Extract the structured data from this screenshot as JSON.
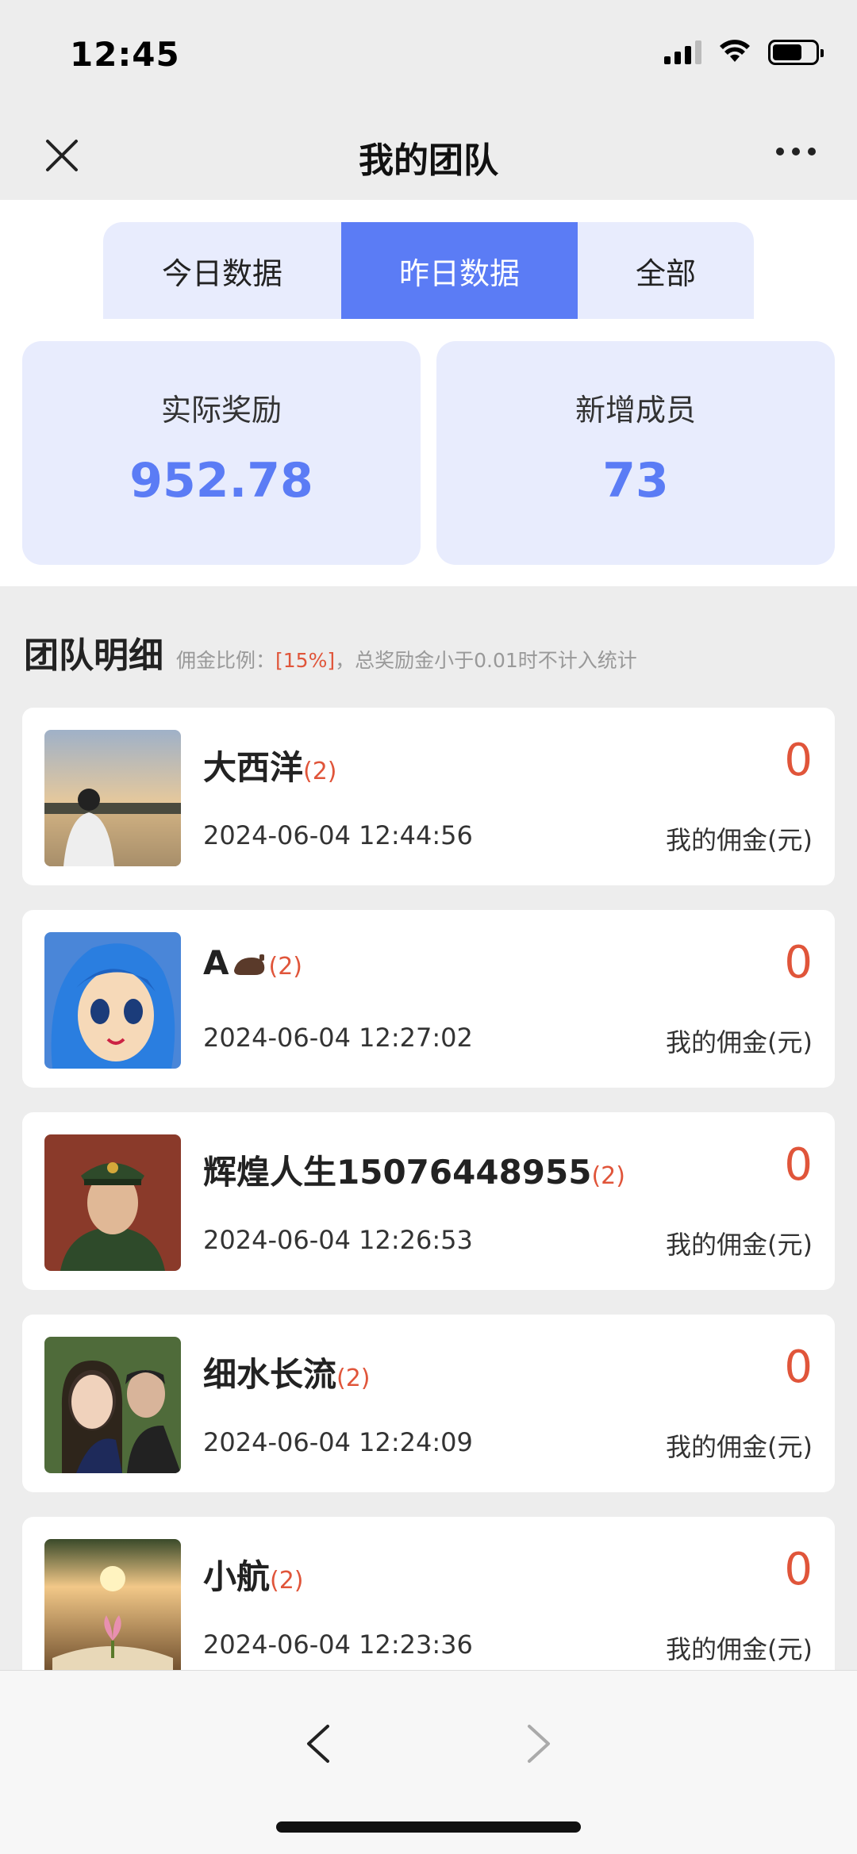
{
  "status_bar": {
    "time": "12:45"
  },
  "header": {
    "title": "我的团队"
  },
  "tabs": [
    {
      "label": "今日数据",
      "active": false
    },
    {
      "label": "昨日数据",
      "active": true
    },
    {
      "label": "全部",
      "active": false
    }
  ],
  "stats": [
    {
      "label": "实际奖励",
      "value": "952.78"
    },
    {
      "label": "新增成员",
      "value": "73"
    }
  ],
  "section": {
    "title": "团队明细",
    "note_prefix": "佣金比例：",
    "note_rate": "[15%]",
    "note_suffix": "，总奖励金小于0.01时不计入统计"
  },
  "members": [
    {
      "name": "大西洋",
      "count": "(2)",
      "time": "2024-06-04 12:44:56",
      "commission": "0",
      "commission_label": "我的佣金(元)"
    },
    {
      "name": "A",
      "count": "(2)",
      "time": "2024-06-04 12:27:02",
      "commission": "0",
      "commission_label": "我的佣金(元)"
    },
    {
      "name": "辉煌人生15076448955",
      "count": "(2)",
      "time": "2024-06-04 12:26:53",
      "commission": "0",
      "commission_label": "我的佣金(元)"
    },
    {
      "name": "细水长流",
      "count": "(2)",
      "time": "2024-06-04 12:24:09",
      "commission": "0",
      "commission_label": "我的佣金(元)"
    },
    {
      "name": "小航",
      "count": "(2)",
      "time": "2024-06-04 12:23:36",
      "commission": "0",
      "commission_label": "我的佣金(元)"
    }
  ],
  "colors": {
    "accent": "#5b7cf5",
    "highlight": "#e0553a",
    "card_bg": "#e8ecfd"
  },
  "icons": [
    "close-icon",
    "more-icon",
    "back-arrow-icon",
    "forward-arrow-icon",
    "signal-icon",
    "wifi-icon",
    "battery-icon"
  ]
}
